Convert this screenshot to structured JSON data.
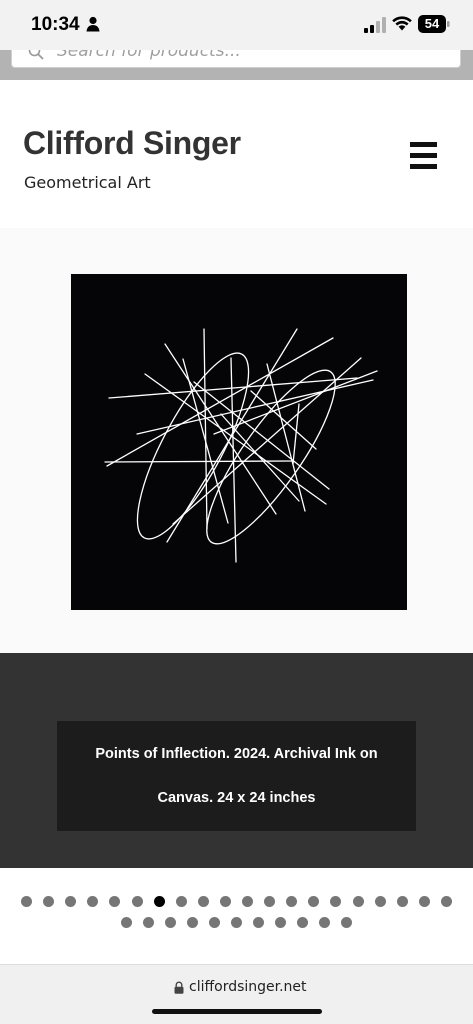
{
  "status_bar": {
    "time": "10:34",
    "battery": "54",
    "icons": [
      "person-icon",
      "signal-icon",
      "wifi-icon",
      "battery-icon"
    ]
  },
  "search": {
    "placeholder": "Search for products..."
  },
  "header": {
    "title": "Clifford Singer",
    "tagline": "Geometrical Art",
    "menu_icon": "hamburger-menu-icon"
  },
  "artwork": {
    "background_color": "#050508",
    "line_color": "#ffffff"
  },
  "caption": {
    "text": "Points of Inflection. 2024. Archival Ink on Canvas. 24 x 24 inches"
  },
  "slider": {
    "ghost_row_count": 19,
    "row1_count": 20,
    "row2_count": 11,
    "active_index": 6,
    "dot_color": "#767676",
    "active_color": "#000000"
  },
  "browser": {
    "url": "cliffordsinger.net"
  }
}
